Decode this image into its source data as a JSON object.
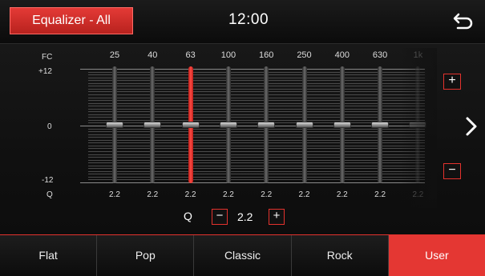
{
  "header": {
    "title": "Equalizer - All",
    "time": "12:00"
  },
  "eq": {
    "fc_label": "FC",
    "scale_top": "+12",
    "scale_mid": "0",
    "scale_bottom": "-12",
    "q_label": "Q",
    "selected_band_index": 2,
    "bands": [
      {
        "freq": "25",
        "gain": 0,
        "q": "2.2"
      },
      {
        "freq": "40",
        "gain": 0,
        "q": "2.2"
      },
      {
        "freq": "63",
        "gain": 0,
        "q": "2.2"
      },
      {
        "freq": "100",
        "gain": 0,
        "q": "2.2"
      },
      {
        "freq": "160",
        "gain": 0,
        "q": "2.2"
      },
      {
        "freq": "250",
        "gain": 0,
        "q": "2.2"
      },
      {
        "freq": "400",
        "gain": 0,
        "q": "2.2"
      },
      {
        "freq": "630",
        "gain": 0,
        "q": "2.2"
      },
      {
        "freq": "1k",
        "gain": 0,
        "q": "2.2"
      }
    ],
    "gain_range": [
      -12,
      12
    ],
    "plus_label": "+",
    "minus_label": "−"
  },
  "q_control": {
    "label": "Q",
    "value": "2.2",
    "minus": "−",
    "plus": "+"
  },
  "presets": [
    "Flat",
    "Pop",
    "Classic",
    "Rock",
    "User"
  ],
  "selected_preset": "User",
  "colors": {
    "accent": "#e43733"
  }
}
